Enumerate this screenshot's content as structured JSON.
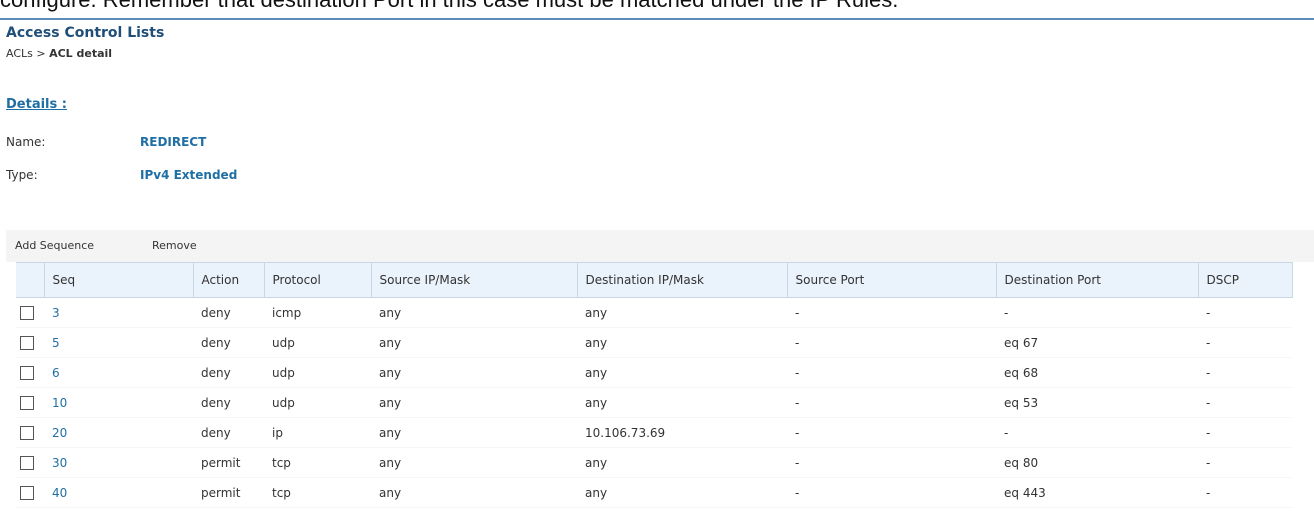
{
  "clipped_banner": "configure. Remember that destination Port in this case must be matched under the IP Rules.",
  "page_title": "Access Control Lists",
  "breadcrumb": {
    "parent": "ACLs",
    "separator": ">",
    "current": "ACL detail"
  },
  "details": {
    "heading": "Details :",
    "name_label": "Name:",
    "name_value": "REDIRECT",
    "type_label": "Type:",
    "type_value": "IPv4 Extended"
  },
  "toolbar": {
    "add_label": "Add Sequence",
    "remove_label": "Remove"
  },
  "table": {
    "columns": [
      "Seq",
      "Action",
      "Protocol",
      "Source IP/Mask",
      "Destination IP/Mask",
      "Source Port",
      "Destination Port",
      "DSCP"
    ],
    "rows": [
      {
        "seq": "3",
        "action": "deny",
        "protocol": "icmp",
        "src": "any",
        "dst": "any",
        "sport": "-",
        "dport": "-",
        "dscp": "-"
      },
      {
        "seq": "5",
        "action": "deny",
        "protocol": "udp",
        "src": "any",
        "dst": "any",
        "sport": "-",
        "dport": "eq 67",
        "dscp": "-"
      },
      {
        "seq": "6",
        "action": "deny",
        "protocol": "udp",
        "src": "any",
        "dst": "any",
        "sport": "-",
        "dport": "eq 68",
        "dscp": "-"
      },
      {
        "seq": "10",
        "action": "deny",
        "protocol": "udp",
        "src": "any",
        "dst": "any",
        "sport": "-",
        "dport": "eq 53",
        "dscp": "-"
      },
      {
        "seq": "20",
        "action": "deny",
        "protocol": "ip",
        "src": "any",
        "dst": "10.106.73.69",
        "sport": "-",
        "dport": "-",
        "dscp": "-"
      },
      {
        "seq": "30",
        "action": "permit",
        "protocol": "tcp",
        "src": "any",
        "dst": "any",
        "sport": "-",
        "dport": "eq 80",
        "dscp": "-"
      },
      {
        "seq": "40",
        "action": "permit",
        "protocol": "tcp",
        "src": "any",
        "dst": "any",
        "sport": "-",
        "dport": "eq 443",
        "dscp": "-"
      }
    ]
  },
  "colors": {
    "accent": "#1f6fa5",
    "title": "#1f4e79",
    "header_bg": "#eaf2fb",
    "toolbar_bg": "#f4f4f4"
  }
}
